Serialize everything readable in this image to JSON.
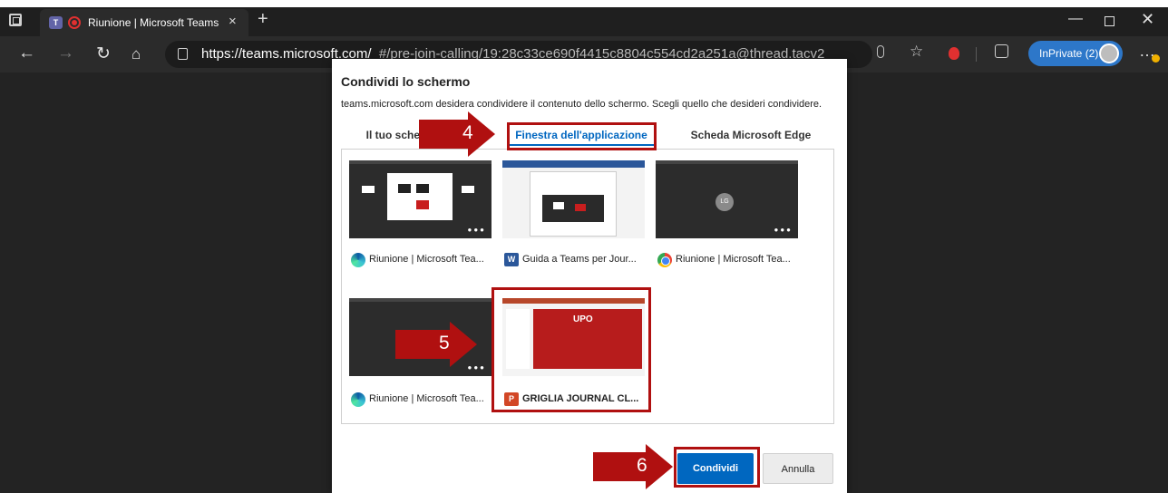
{
  "browser": {
    "tab_title": "Riunione | Microsoft Teams",
    "tab_close": "×",
    "new_tab": "+",
    "url_domain": "https://teams.microsoft.com/",
    "url_path": "_#/pre-join-calling/19:28c33ce690f4415c8804c554cd2a251a@thread.tacv2",
    "inprivate_label": "InPrivate (2)"
  },
  "dialog": {
    "title": "Condividi lo schermo",
    "description": "teams.microsoft.com desidera condividere il contenuto dello schermo. Scegli quello che desideri condividere.",
    "tabs": [
      {
        "label": "Il tuo schermo intero"
      },
      {
        "label": "Finestra dell'applicazione"
      },
      {
        "label": "Scheda Microsoft Edge"
      }
    ],
    "windows": [
      {
        "label": "Riunione | Microsoft Tea...",
        "icon": "edge-icon"
      },
      {
        "label": "Guida a Teams per Jour...",
        "icon": "word-icon"
      },
      {
        "label": "Riunione | Microsoft Tea...",
        "icon": "chrome-icon"
      },
      {
        "label": "Riunione | Microsoft Tea...",
        "icon": "edge-icon"
      },
      {
        "label": "GRIGLIA JOURNAL CL...",
        "icon": "powerpoint-icon"
      }
    ],
    "thumb_avatar_initials": "LG",
    "ppt_thumb_logo": "UPO",
    "share_label": "Condividi",
    "cancel_label": "Annulla"
  },
  "annotations": {
    "step4": "4",
    "step5": "5",
    "step6": "6"
  },
  "colors": {
    "accent": "#0067c0",
    "annotation_red": "#b01010",
    "inprivate_blue": "#2d77c9"
  }
}
